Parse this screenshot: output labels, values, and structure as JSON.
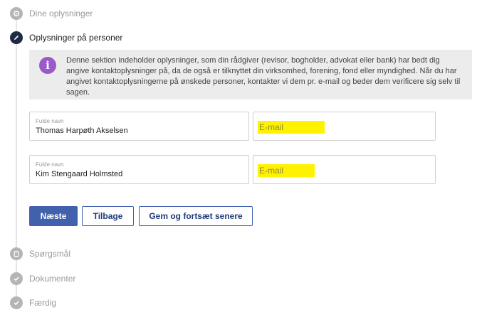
{
  "steps": {
    "dine": {
      "label": "Dine oplysninger",
      "icon": "gear-icon"
    },
    "personer": {
      "label": "Oplysninger på personer",
      "icon": "pencil-icon"
    },
    "spoergsmaal": {
      "label": "Spørgsmål",
      "icon": "clipboard-icon"
    },
    "dokumenter": {
      "label": "Dokumenter",
      "icon": "check-icon"
    },
    "faerdig": {
      "label": "Færdig",
      "icon": "check-icon"
    }
  },
  "info": {
    "icon": "info-icon",
    "text": "Denne sektion indeholder oplysninger, som din rådgiver (revisor, bogholder, advokat eller bank) har bedt dig angive kontaktoplysninger på, da de også er tilknyttet din virksomhed, forening, fond eller myndighed. Når du har angivet kontaktoplysningerne på ønskede personer, kontakter vi dem pr. e-mail og beder dem verificere sig selv til sagen."
  },
  "persons": [
    {
      "name_label": "Fulde navn",
      "name_value": "Thomas Harpøth Akselsen",
      "email_placeholder": "E-mail",
      "email_value": ""
    },
    {
      "name_label": "Fulde navn",
      "name_value": "Kim Stengaard Holmsted",
      "email_placeholder": "E-mail",
      "email_value": ""
    }
  ],
  "buttons": {
    "next": "Næste",
    "back": "Tilbage",
    "save_later": "Gem og fortsæt senere"
  },
  "colors": {
    "primary": "#4161ad",
    "highlight": "#fff200",
    "info_icon": "#9b59c9",
    "active_step": "#1f2a44"
  }
}
